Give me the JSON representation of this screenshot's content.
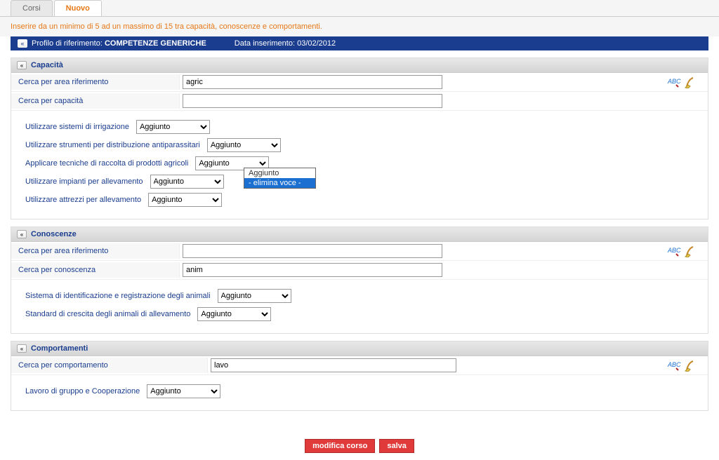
{
  "tabs": {
    "corsi": "Corsi",
    "nuovo": "Nuovo"
  },
  "info_text": "Inserire da un minimo di 5 ad un massimo di 15 tra capacità, conoscenze e comportamenti.",
  "profile": {
    "label": "Profilo di riferimento:",
    "name": "COMPETENZE GENERICHE",
    "date_label": "Data inserimento:",
    "date": "03/02/2012"
  },
  "capacita": {
    "title": "Capacità",
    "search_area_label": "Cerca per area riferimento",
    "search_area_value": "agric",
    "search_cap_label": "Cerca per capacità",
    "search_cap_value": "",
    "items": [
      {
        "label": "Utilizzare sistemi di irrigazione",
        "value": "Aggiunto"
      },
      {
        "label": "Utilizzare strumenti per distribuzione antiparassitari",
        "value": "Aggiunto"
      },
      {
        "label": "Applicare tecniche di raccolta di prodotti agricoli",
        "value": "Aggiunto"
      },
      {
        "label": "Utilizzare impianti per allevamento",
        "value": "Aggiunto"
      },
      {
        "label": "Utilizzare attrezzi per allevamento",
        "value": "Aggiunto"
      }
    ],
    "dropdown_options": {
      "opt1": "Aggiunto",
      "opt2": "- elimina voce -"
    }
  },
  "conoscenze": {
    "title": "Conoscenze",
    "search_area_label": "Cerca per area riferimento",
    "search_area_value": "",
    "search_con_label": "Cerca per conoscenza",
    "search_con_value": "anim",
    "items": [
      {
        "label": "Sistema di identificazione e registrazione degli animali",
        "value": "Aggiunto"
      },
      {
        "label": "Standard di crescita degli animali di allevamento",
        "value": "Aggiunto"
      }
    ]
  },
  "comportamenti": {
    "title": "Comportamenti",
    "search_label": "Cerca per comportamento",
    "search_value": "lavo",
    "items": [
      {
        "label": "Lavoro di gruppo e Cooperazione",
        "value": "Aggiunto"
      }
    ]
  },
  "buttons": {
    "modifica": "modifica corso",
    "salva": "salva"
  }
}
